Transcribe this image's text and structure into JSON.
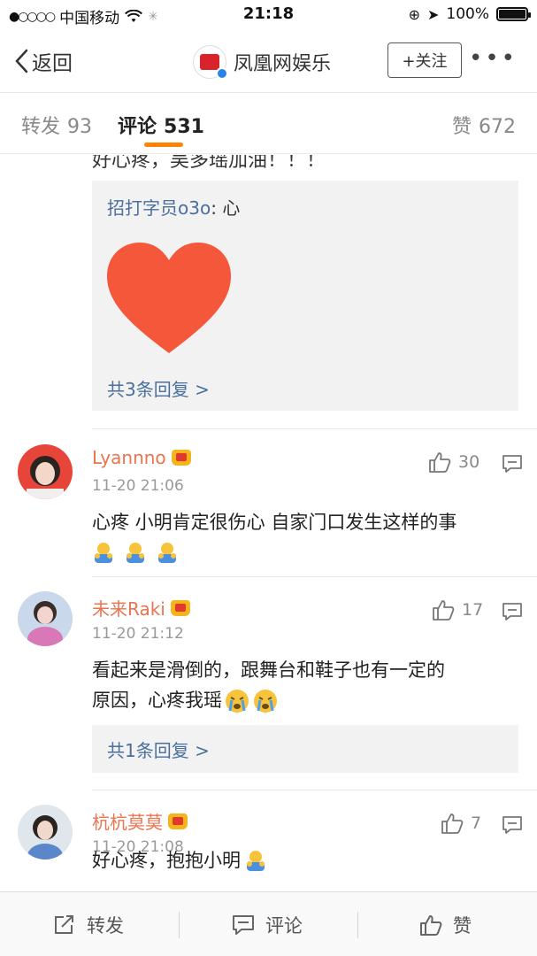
{
  "status_bar": {
    "carrier": "中国移动",
    "time": "21:18",
    "battery": "100%",
    "battery_level": 1.0
  },
  "nav": {
    "back_label": "返回",
    "title": "凤凰网娱乐",
    "follow_label": "+关注",
    "more_label": "•••"
  },
  "tabs": {
    "repost": {
      "label": "转发",
      "count": "93"
    },
    "comments": {
      "label": "评论",
      "count": "531"
    },
    "likes": {
      "label": "赞",
      "count": "672"
    }
  },
  "feed": {
    "cut_text": "好心疼，吴多瑶加油！！！",
    "top_reply_box": {
      "reply_user": "招打字员o3o",
      "reply_sep": ": ",
      "reply_text": "心",
      "more_replies": "共3条回复 >"
    },
    "comments": [
      {
        "user": "Lyannno",
        "time": "11-20 21:06",
        "likes": "30",
        "text": "心疼  小明肯定很伤心 自家门口发生这样的事"
      },
      {
        "user": "未来Raki",
        "time": "11-20 21:12",
        "likes": "17",
        "text_line1": "看起来是滑倒的，跟舞台和鞋子也有一定的",
        "text_line2": "原因，心疼我瑶",
        "more_replies": "共1条回复 >"
      },
      {
        "user": "杭杭莫莫",
        "time": "11-20 21:08",
        "likes": "7",
        "text": "好心疼，抱抱小明"
      }
    ]
  },
  "bottom_bar": {
    "repost": "转发",
    "comment": "评论",
    "like": "赞"
  },
  "colors": {
    "accent_orange": "#ff8200",
    "username": "#eb7350",
    "link_blue": "#4a6f9e",
    "heart_red": "#f5573a"
  },
  "icons": [
    "back-chevron-icon",
    "crown-badge-icon",
    "thumb-up-icon",
    "comment-icon",
    "repost-icon",
    "heart-emoji",
    "hug-emoji",
    "crying-emoji"
  ]
}
